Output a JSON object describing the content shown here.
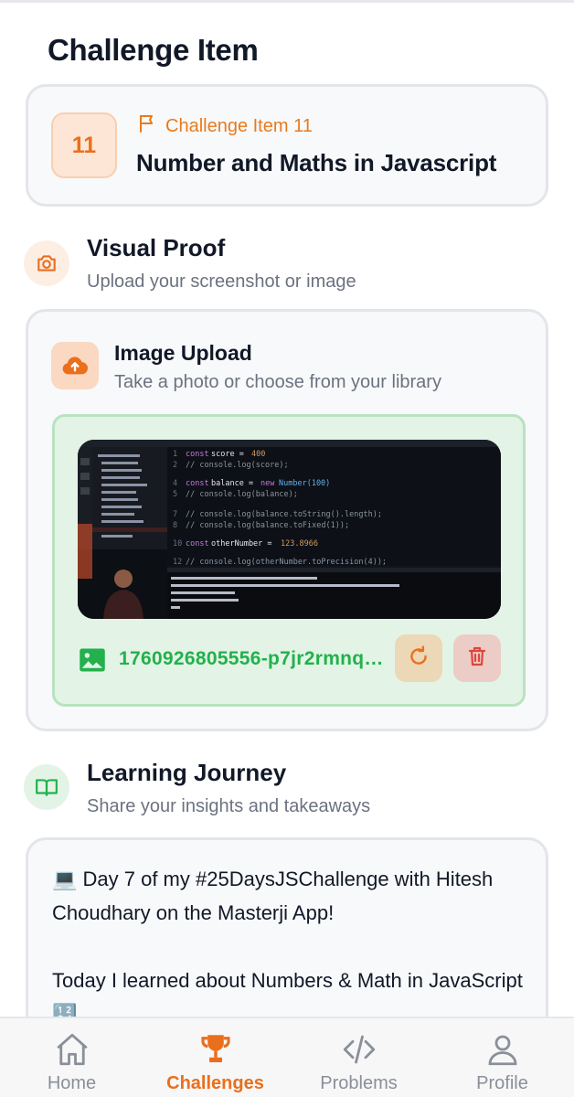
{
  "page": {
    "title": "Challenge Item"
  },
  "challenge": {
    "number": "11",
    "subtitle": "Challenge Item 11",
    "name": "Number and Maths in Javascript",
    "flag_icon": "flag-icon"
  },
  "visual_proof": {
    "title": "Visual Proof",
    "subtitle": "Upload your screenshot or image",
    "icon": "camera-icon"
  },
  "upload": {
    "title": "Image Upload",
    "subtitle": "Take a photo or choose from your library",
    "icon": "cloud-upload-icon",
    "file_name": "1760926805556-p7jr2rmnq9j...",
    "file_icon": "image-icon",
    "replace_icon": "refresh-icon",
    "delete_icon": "trash-icon"
  },
  "journey": {
    "title": "Learning Journey",
    "subtitle": "Share your insights and takeaways",
    "icon": "book-icon",
    "text": "💻 Day 7 of my #25DaysJSChallenge with Hitesh Choudhary on the Masterji App!\n\nToday I learned about Numbers & Math in JavaScript 🔢"
  },
  "nav": {
    "items": [
      {
        "label": "Home",
        "icon": "home-icon"
      },
      {
        "label": "Challenges",
        "icon": "trophy-icon",
        "active": true
      },
      {
        "label": "Problems",
        "icon": "code-icon"
      },
      {
        "label": "Profile",
        "icon": "user-icon"
      }
    ]
  },
  "colors": {
    "accent": "#ea6f1c",
    "success": "#22b14c",
    "danger": "#e0453a"
  }
}
